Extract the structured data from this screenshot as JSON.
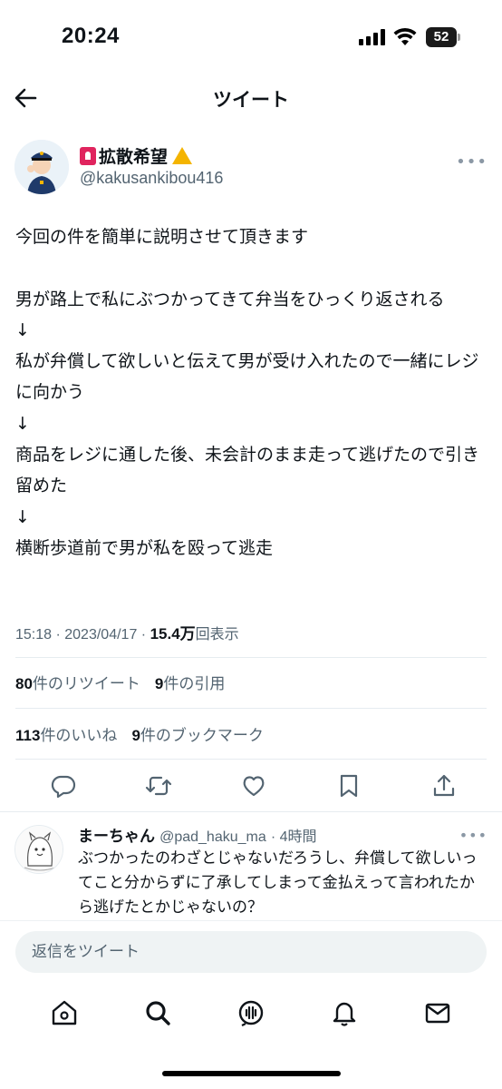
{
  "status_bar": {
    "time": "20:24",
    "battery": "52"
  },
  "header": {
    "title": "ツイート"
  },
  "tweet": {
    "author_name": "拡散希望",
    "author_handle": "@kakusankibou416",
    "body": "今回の件を簡単に説明させて頂きます\n\n男が路上で私にぶつかってきて弁当をひっくり返される\n↓\n私が弁償して欲しいと伝えて男が受け入れたので一緒にレジに向かう\n↓\n商品をレジに通した後、未会計のまま走って逃げたので引き留めた\n↓\n横断歩道前で男が私を殴って逃走",
    "timestamp": "15:18 · 2023/04/17 · ",
    "views_count": "15.4万",
    "views_label": "回表示"
  },
  "stats": {
    "retweets_count": "80",
    "retweets_label": "件のリツイート",
    "quotes_count": "9",
    "quotes_label": "件の引用",
    "likes_count": "113",
    "likes_label": "件のいいね",
    "bookmarks_count": "9",
    "bookmarks_label": "件のブックマーク"
  },
  "actions": [
    "reply-icon",
    "retweet-icon",
    "like-icon",
    "bookmark-icon",
    "share-icon"
  ],
  "reply": {
    "name": "まーちゃん",
    "handle": "@pad_haku_ma",
    "time": "· 4時間",
    "text": "ぶつかったのわざとじゃないだろうし、弁償して欲しいってこと分からずに了承してしまって金払えって言われたから逃げたとかじゃないの？"
  },
  "reply_box": {
    "placeholder": "返信をツイート"
  },
  "bottom_nav": [
    "home-icon",
    "search-icon",
    "spaces-icon",
    "notifications-icon",
    "messages-icon"
  ],
  "colors": {
    "text": "#0f1419",
    "secondary": "#536471",
    "divider": "#e6ecf0"
  }
}
